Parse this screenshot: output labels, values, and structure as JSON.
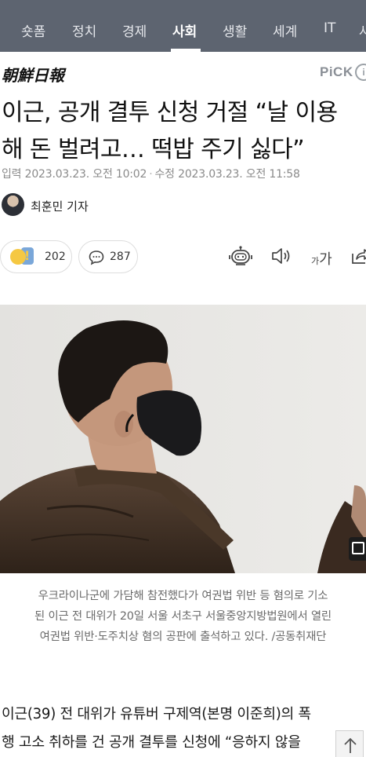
{
  "nav": {
    "tabs": [
      {
        "label": "숏폼",
        "active": false
      },
      {
        "label": "정치",
        "active": false
      },
      {
        "label": "경제",
        "active": false
      },
      {
        "label": "사회",
        "active": true
      },
      {
        "label": "생활",
        "active": false
      },
      {
        "label": "세계",
        "active": false
      },
      {
        "label": "IT",
        "active": false
      },
      {
        "label": "사",
        "active": false
      }
    ]
  },
  "brand": {
    "logo_text": "朝鮮日報",
    "pick_label": "PiCK",
    "pick_badge": "i"
  },
  "article": {
    "headline_lines": [
      "이근, 공개 결투 신청 거절 “날 이용",
      "해 돈 벌려고… 떡밥 주기 싫다”"
    ],
    "input_date": "입력 2023.03.23. 오전 10:02",
    "separator": "·",
    "updated_date": "수정 2023.03.23. 오전 11:58",
    "reporter": "최훈민 기자",
    "reaction_count": "202",
    "comment_count": "287",
    "font_size_label": "가가",
    "caption_lines": [
      "우크라이나군에 가담해 참전했다가 여권법 위반 등 혐의로 기소",
      "된 이근 전 대위가 20일 서울 서초구 서울중앙지방법원에서 열린",
      "여권법 위반·도주치상 혐의 공판에 출석하고 있다. /공동취재단"
    ],
    "body_lines": [
      "이근(39) 전 대위가 유튜버 구제역(본명 이준희)의 폭",
      "행 고소 취하를 건 공개 결투를 신청에 “응하지 않을"
    ]
  },
  "colors": {
    "nav_bg": "#5d6470",
    "nav_text": "#e6e8ec",
    "caption": "#6b6b6b",
    "meta": "#8a8a8a"
  },
  "icons": [
    "reaction-emoji-icon",
    "comment-icon",
    "summary-bot-icon",
    "speaker-icon",
    "font-size-icon",
    "share-icon",
    "expand-icon",
    "scroll-top-icon"
  ]
}
